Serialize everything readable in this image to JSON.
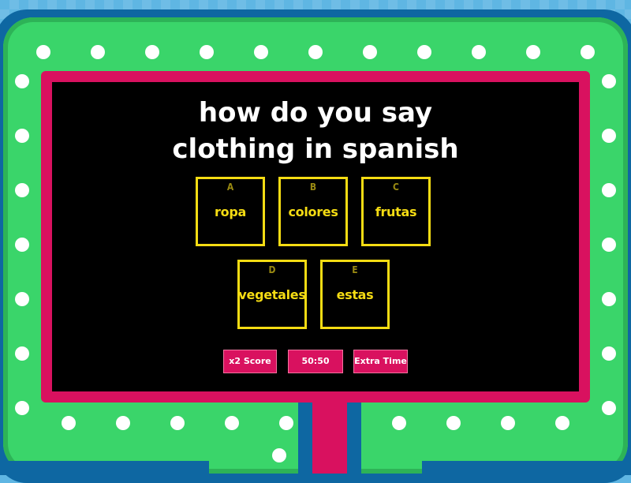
{
  "question": {
    "line1": "how do you say",
    "line2": "clothing in spanish"
  },
  "answers": [
    {
      "letter": "A",
      "text": "ropa"
    },
    {
      "letter": "B",
      "text": "colores"
    },
    {
      "letter": "C",
      "text": "frutas"
    },
    {
      "letter": "D",
      "text": "vegetales"
    },
    {
      "letter": "E",
      "text": "estas"
    }
  ],
  "powerups": [
    {
      "label": "x2 Score"
    },
    {
      "label": "50:50"
    },
    {
      "label": "Extra Time"
    }
  ],
  "colors": {
    "background": "#5fb6e3",
    "frame_dark": "#0e67a2",
    "frame_green": "#3ad56a",
    "panel_pink": "#d9115f",
    "screen": "#000000",
    "answer_yellow": "#f5dc13",
    "bulb": "#ffffff"
  }
}
